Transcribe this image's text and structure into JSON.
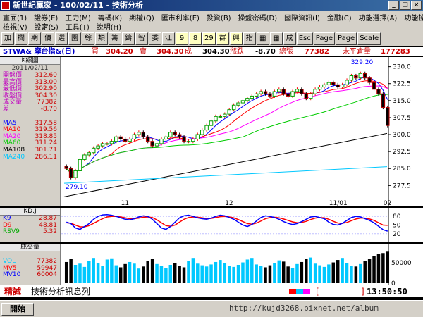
{
  "window": {
    "title": "新世紀贏家 - 100/02/11 - 技術分析"
  },
  "menu": {
    "row1": [
      "畫面(1)",
      "證券(E)",
      "主力(M)",
      "籌碼(K)",
      "期權(Q)",
      "匯市利率(E)",
      "投資(B)",
      "操盤密碼(D)",
      "國際資訊(I)",
      "金融(C)",
      "功能選擇(A)",
      "功能操作(Z)"
    ],
    "row2": [
      "檢視(V)",
      "設定(S)",
      "工具(T)",
      "說明(H)"
    ]
  },
  "toolbar": {
    "buttons": [
      "加",
      "欄",
      "期",
      "價",
      "選",
      "園",
      "綜",
      "類",
      "籌",
      "鑄",
      "智",
      "委",
      "江",
      "9",
      "8",
      "29",
      "群",
      "興",
      "指",
      "▦",
      "▦",
      "成",
      "Esc",
      "Page",
      "Page",
      "Scale"
    ]
  },
  "info": {
    "symbol": "STWA& 摩台指&(日)",
    "buy_label": "買",
    "buy": "304.20",
    "sell_label": "賣",
    "sell": "304.30",
    "deal_label": "成",
    "deal": "304.30",
    "chg_label": "漲跌",
    "chg": "-8.70",
    "vol_label": "總張",
    "vol": "77382",
    "oi_label": "未平倉量",
    "oi": "177283"
  },
  "kpanel": {
    "title": "K線圖",
    "date": "2011/02/11",
    "rows": [
      {
        "label": "開盤價",
        "value": "312.60"
      },
      {
        "label": "最高價",
        "value": "313.00"
      },
      {
        "label": "最低價",
        "value": "302.90"
      },
      {
        "label": "收盤價",
        "value": "304.30"
      },
      {
        "label": "成交量",
        "value": "77382"
      },
      {
        "label": "差",
        "value": "-8.70"
      }
    ],
    "ma": [
      {
        "label": "MA5",
        "value": "317.58",
        "color": "#0000ff"
      },
      {
        "label": "MA10",
        "value": "319.56",
        "color": "#ff0000"
      },
      {
        "label": "MA20",
        "value": "318.85",
        "color": "#ff00ff"
      },
      {
        "label": "MA60",
        "value": "311.24",
        "color": "#00cc00"
      },
      {
        "label": "MA108",
        "value": "301.71",
        "color": "#000000"
      },
      {
        "label": "MA240",
        "value": "286.11",
        "color": "#00c8ff"
      }
    ]
  },
  "kdpanel": {
    "title": "KD,J",
    "rows": [
      {
        "label": "K9",
        "value": "28.87",
        "color": "#0000ff"
      },
      {
        "label": "D9",
        "value": "48.81",
        "color": "#ff0000"
      },
      {
        "label": "RSV9",
        "value": "5.32",
        "color": "#00aa00"
      }
    ]
  },
  "volpanel": {
    "title": "成交量",
    "rows": [
      {
        "label": "VOL",
        "value": "77382",
        "color": "#00c8ff"
      },
      {
        "label": "MV5",
        "value": "59947",
        "color": "#ff0000"
      },
      {
        "label": "MV10",
        "value": "60004",
        "color": "#0000ff"
      }
    ]
  },
  "chart_data": {
    "type": "candlestick",
    "y_ticks": [
      "330.0",
      "322.5",
      "315.0",
      "307.5",
      "300.0",
      "292.5",
      "285.0",
      "277.5"
    ],
    "ylim": [
      272,
      333
    ],
    "x_labels": [
      "11",
      "12",
      "11/01",
      "02"
    ],
    "max_label": "329.20",
    "min_label": "279.10",
    "kd_ticks": [
      "80",
      "50",
      "20"
    ],
    "vol_ticks": [
      "50000",
      "0"
    ],
    "open": [
      286,
      285,
      281,
      284,
      289,
      291,
      292,
      294,
      295,
      296,
      296,
      297,
      299,
      298,
      297,
      298,
      300,
      301,
      299,
      297,
      295,
      296,
      298,
      299,
      301,
      300,
      299,
      297,
      297,
      298,
      300,
      302,
      304,
      306,
      308,
      308,
      309,
      311,
      313,
      314,
      315,
      316,
      317,
      318,
      319,
      318,
      317,
      319,
      320,
      318,
      317,
      319,
      320,
      318,
      316,
      318,
      320,
      321,
      322,
      323,
      322,
      321,
      322,
      324,
      326,
      325,
      327,
      325,
      323,
      320,
      318,
      312
    ],
    "close": [
      285,
      281,
      284,
      289,
      291,
      292,
      294,
      295,
      296,
      296,
      297,
      299,
      298,
      297,
      298,
      300,
      301,
      299,
      297,
      295,
      296,
      298,
      299,
      301,
      300,
      299,
      297,
      297,
      298,
      300,
      302,
      304,
      306,
      308,
      308,
      309,
      311,
      313,
      314,
      315,
      316,
      317,
      318,
      319,
      318,
      317,
      319,
      320,
      318,
      317,
      319,
      320,
      318,
      316,
      318,
      320,
      321,
      322,
      323,
      322,
      321,
      322,
      324,
      326,
      325,
      327,
      325,
      323,
      320,
      318,
      312,
      304
    ],
    "kd_k": [
      60,
      55,
      40,
      35,
      45,
      55,
      70,
      80,
      85,
      86,
      84,
      80,
      75,
      70,
      68,
      72,
      78,
      82,
      80,
      70,
      55,
      40,
      35,
      45,
      60,
      75,
      82,
      84,
      80,
      75,
      72,
      70,
      74,
      80,
      84,
      82,
      76,
      70,
      60,
      50,
      45,
      52,
      64,
      76,
      82,
      80,
      76,
      70,
      62,
      56,
      52,
      55,
      62,
      70,
      78,
      80,
      76,
      72,
      60,
      52,
      50,
      56,
      66,
      76,
      80,
      78,
      72,
      66,
      58,
      46,
      34,
      29
    ],
    "kd_d": [
      58,
      56,
      50,
      44,
      44,
      48,
      56,
      64,
      72,
      78,
      80,
      80,
      78,
      75,
      72,
      72,
      74,
      77,
      78,
      76,
      68,
      58,
      48,
      46,
      50,
      60,
      70,
      76,
      78,
      77,
      75,
      73,
      73,
      76,
      79,
      80,
      78,
      75,
      69,
      62,
      55,
      53,
      57,
      64,
      72,
      76,
      77,
      75,
      71,
      66,
      61,
      58,
      59,
      63,
      69,
      74,
      76,
      75,
      70,
      63,
      57,
      56,
      59,
      65,
      71,
      74,
      74,
      71,
      66,
      58,
      50,
      49
    ],
    "volume": [
      52000,
      60000,
      45000,
      48000,
      40000,
      55000,
      62000,
      50000,
      43000,
      58000,
      61000,
      44000,
      39000,
      47000,
      52000,
      48000,
      36000,
      41000,
      54000,
      60000,
      47000,
      43000,
      38000,
      45000,
      50000,
      42000,
      39000,
      55000,
      62000,
      48000,
      44000,
      41000,
      46000,
      52000,
      57000,
      49000,
      43000,
      40000,
      45000,
      51000,
      58000,
      62000,
      46000,
      42000,
      39000,
      44000,
      50000,
      56000,
      53000,
      41000,
      38000,
      47000,
      52000,
      59000,
      63000,
      48000,
      44000,
      40000,
      46000,
      51000,
      57000,
      62000,
      49000,
      43000,
      41000,
      47000,
      55000,
      60000,
      66000,
      71000,
      74000,
      77382
    ]
  },
  "status": {
    "left_title": "精誠",
    "message": "技術分析訊息列",
    "bracket_l": "[",
    "bracket_r": "]",
    "time": "13:50:50"
  },
  "taskbar": {
    "start": "開始",
    "watermark": "http://kujd3268.pixnet.net/album"
  }
}
